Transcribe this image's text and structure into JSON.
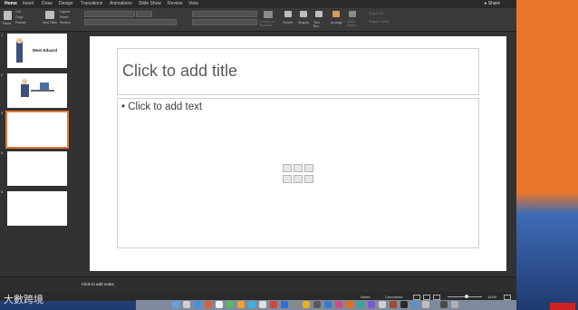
{
  "tabs": [
    "Home",
    "Insert",
    "Draw",
    "Design",
    "Transitions",
    "Animations",
    "Slide Show",
    "Review",
    "View"
  ],
  "share_label": "Share",
  "ribbon": {
    "paste": "Paste",
    "cut": "Cut",
    "copy": "Copy",
    "format": "Format",
    "new_slide": "New Slide",
    "layout": "Layout",
    "reset": "Reset",
    "section": "Section",
    "convert_smartart": "Convert to SmartArt",
    "picture": "Picture",
    "shapes": "Shapes",
    "text_box": "Text Box",
    "arrange": "Arrange",
    "quick_styles": "Quick Styles",
    "shape_fill": "Shape Fill",
    "shape_outline": "Shape Outline"
  },
  "thumbnails": [
    {
      "num": "1",
      "text": "Meet Eduard"
    },
    {
      "num": "2",
      "text": ""
    },
    {
      "num": "3",
      "text": ""
    },
    {
      "num": "4",
      "text": ""
    },
    {
      "num": "5",
      "text": ""
    }
  ],
  "slide": {
    "title_placeholder": "Click to add title",
    "body_placeholder": "• Click to add text"
  },
  "notes_placeholder": "Click to add notes",
  "status": {
    "notes": "Notes",
    "comments": "Comments",
    "zoom": "144%"
  },
  "watermark": "大數跨境",
  "colors": {
    "selected_thumb_border": "#e07a3a",
    "desktop_orange": "#e8772a",
    "desktop_blue": "#2b4d8c"
  }
}
